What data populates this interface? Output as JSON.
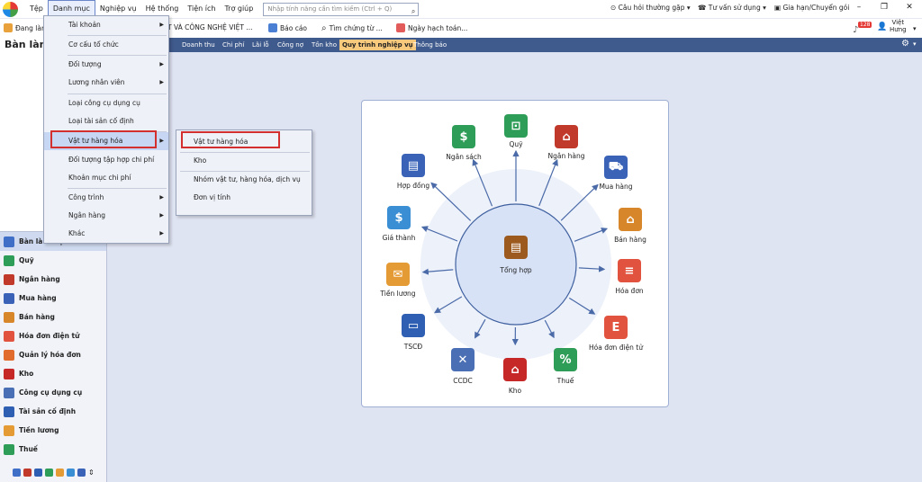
{
  "menubar": {
    "items": [
      "Tệp",
      "Danh mục",
      "Nghiệp vụ",
      "Hệ thống",
      "Tiện ích",
      "Trợ giúp"
    ],
    "search_placeholder": "Nhập tính năng cần tìm kiếm (Ctrl + Q)",
    "faq": "Câu hỏi thường gặp",
    "advisor": "Tư vấn sử dụng",
    "renew": "Gia hạn/Chuyển gói",
    "window": {
      "min": "–",
      "max": "❐",
      "close": "✕"
    }
  },
  "toolbar": {
    "working": "Đang làm",
    "company": "T VÀ CÔNG NGHỆ VIỆT ...",
    "report": "Báo cáo",
    "find": "Tìm chứng từ ...",
    "date": "Ngày hạch toán...",
    "notify_count": "128",
    "user": "Việt",
    "user2": "Hưng"
  },
  "page_title": "Bàn làm",
  "tabs": [
    "Doanh thu",
    "Chi phí",
    "Lãi lỗ",
    "Công nợ",
    "Tồn kho",
    "Quy trình nghiệp vụ",
    "Thông báo"
  ],
  "dropdown": {
    "items": [
      "Tài khoản",
      "Cơ cấu tổ chức",
      "Đối tượng",
      "Lương nhân viên",
      "Loại công cụ dụng cụ",
      "Loại tài sản cố định",
      "Vật tư hàng hóa",
      "Đối tượng tập hợp chi phí",
      "Khoản mục chi phí",
      "Công trình",
      "Ngân hàng",
      "Khác"
    ]
  },
  "submenu": {
    "items": [
      "Vật tư hàng hóa",
      "Kho",
      "Nhóm vật tư, hàng hóa, dịch vụ",
      "Đơn vị tính"
    ]
  },
  "leftnav": {
    "items": [
      "Bàn làm việc",
      "Quỹ",
      "Ngân hàng",
      "Mua hàng",
      "Bán hàng",
      "Hóa đơn điện tử",
      "Quản lý hóa đơn",
      "Kho",
      "Công cụ dụng cụ",
      "Tài sản cố định",
      "Tiền lương",
      "Thuế"
    ]
  },
  "diagram": {
    "center": "Tổng hợp",
    "nodes": [
      "Quỹ",
      "Ngân hàng",
      "Mua hàng",
      "Bán hàng",
      "Hóa đơn",
      "Hóa đơn điện tử",
      "Thuế",
      "Kho",
      "CCDC",
      "TSCĐ",
      "Tiền lương",
      "Giá thành",
      "Hợp đồng",
      "Ngân sách"
    ]
  }
}
